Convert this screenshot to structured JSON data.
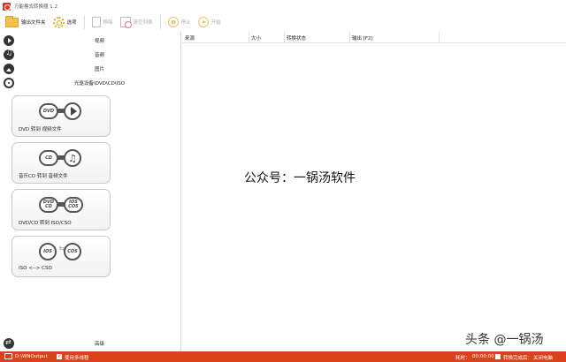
{
  "window": {
    "title": "万能格式转换器 1.2"
  },
  "toolbar": {
    "output_folder": "输出文件夹",
    "options": "选项",
    "remove": "移除",
    "clear_list": "清空列表",
    "stop": "停止",
    "start": "开始"
  },
  "sidebar": {
    "categories": [
      {
        "label": "视频",
        "icon": "play-icon"
      },
      {
        "label": "音频",
        "icon": "music-icon"
      },
      {
        "label": "图片",
        "icon": "image-icon"
      },
      {
        "label": "光驱设备\\DVD\\CD\\ISO",
        "icon": "disc-icon"
      }
    ],
    "cards": [
      {
        "label": "DVD 转到 视频文件",
        "from": "DVD",
        "to": "play"
      },
      {
        "label": "音乐CD 转到 音频文件",
        "from": "CD",
        "to": "music"
      },
      {
        "label": "DVD/CD 转到 ISO/CSO",
        "from": "DVD CD",
        "to": "IOS COS"
      },
      {
        "label": "ISO <--> CSO",
        "from": "IOS",
        "to": "COS"
      }
    ],
    "advanced": "高级"
  },
  "table": {
    "columns": [
      "来源",
      "大小",
      "转换状态",
      "输出 [F2]"
    ]
  },
  "watermark": {
    "main": "公众号：一锅汤软件",
    "corner": "头条 @一锅汤"
  },
  "status": {
    "output_path": "D:\\WNOutput",
    "multithread": "使用多线程",
    "elapsed_label": "耗时：",
    "elapsed": "00:00:00",
    "after_convert": "转换完成后：",
    "shutdown": "关闭电脑"
  },
  "colors": {
    "status_bar": "#d8431b",
    "accent": "#e3a927"
  }
}
